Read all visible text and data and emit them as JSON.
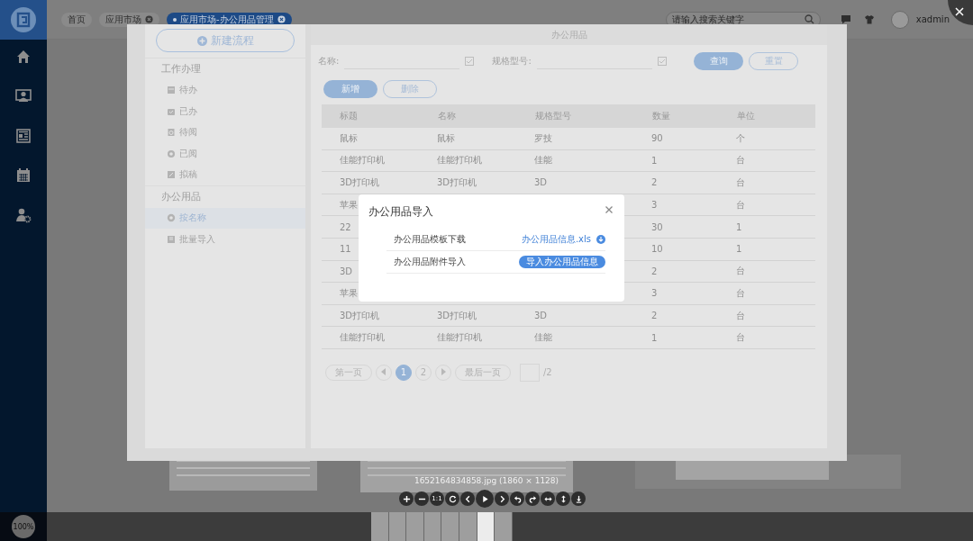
{
  "app": {
    "tabs": [
      {
        "label": "首页",
        "closable": false,
        "selected": false
      },
      {
        "label": "应用市场",
        "closable": true,
        "selected": false
      },
      {
        "label": "应用市场-办公用品管理",
        "closable": true,
        "selected": true
      }
    ],
    "search": {
      "placeholder": "请输入搜索关键字"
    },
    "user": "xadmin"
  },
  "viewer": {
    "image": {
      "sidebar": {
        "new_button": "新建流程",
        "sections": [
          {
            "title": "工作办理",
            "items": [
              {
                "label": "待办",
                "selected": false
              },
              {
                "label": "已办",
                "selected": false
              },
              {
                "label": "待阅",
                "selected": false
              },
              {
                "label": "已阅",
                "selected": false
              },
              {
                "label": "拟稿",
                "selected": false
              }
            ]
          },
          {
            "title": "办公用品",
            "items": [
              {
                "label": "按名称",
                "selected": true
              },
              {
                "label": "批量导入",
                "selected": false
              }
            ]
          }
        ]
      },
      "panel": {
        "title": "办公用品",
        "filters": [
          {
            "label": "名称:"
          },
          {
            "label": "规格型号:"
          }
        ],
        "query_button": "查询",
        "reset_button": "重置",
        "add_button": "新增",
        "delete_button": "删除",
        "table": {
          "columns": [
            "标题",
            "名称",
            "规格型号",
            "数量",
            "单位"
          ],
          "rows": [
            {
              "title": "鼠标",
              "name": "鼠标",
              "model": "罗技",
              "quantity": "90",
              "unit": "个"
            },
            {
              "title": "佳能打印机",
              "name": "佳能打印机",
              "model": "佳能",
              "quantity": "1",
              "unit": "台"
            },
            {
              "title": "3D打印机",
              "name": "3D打印机",
              "model": "3D",
              "quantity": "2",
              "unit": "台"
            },
            {
              "title": "苹果",
              "quantity": "3",
              "unit": "台"
            },
            {
              "title": "22",
              "quantity": "30",
              "unit": "1"
            },
            {
              "title": "11",
              "quantity": "10",
              "unit": "1"
            },
            {
              "title": "3D",
              "quantity": "2",
              "unit": "台"
            },
            {
              "title": "苹果",
              "quantity": "3",
              "unit": "台"
            },
            {
              "title": "3D打印机",
              "name": "3D打印机",
              "model": "3D",
              "quantity": "2",
              "unit": "台"
            },
            {
              "title": "佳能打印机",
              "name": "佳能打印机",
              "model": "佳能",
              "quantity": "1",
              "unit": "台"
            }
          ]
        },
        "pagination": {
          "first": "第一页",
          "pages": [
            {
              "label": "1",
              "selected": true
            },
            {
              "label": "2",
              "selected": false
            }
          ],
          "last": "最后一页",
          "total": "/2"
        }
      },
      "dialog": {
        "title": "办公用品导入",
        "rows": [
          {
            "label": "办公用品模板下载",
            "kind": "link",
            "action": "办公用品信息.xls"
          },
          {
            "label": "办公用品附件导入",
            "kind": "button",
            "action": "导入办公用品信息"
          }
        ]
      }
    },
    "caption": "1652164834858.jpg (1860 × 1128)",
    "one_to_one": "1:1",
    "zoom": "100%",
    "thumbnails": [
      {
        "selected": false
      },
      {
        "selected": false
      },
      {
        "selected": false
      },
      {
        "selected": false
      },
      {
        "selected": false
      },
      {
        "selected": false
      },
      {
        "selected": true
      },
      {
        "selected": false
      }
    ]
  }
}
